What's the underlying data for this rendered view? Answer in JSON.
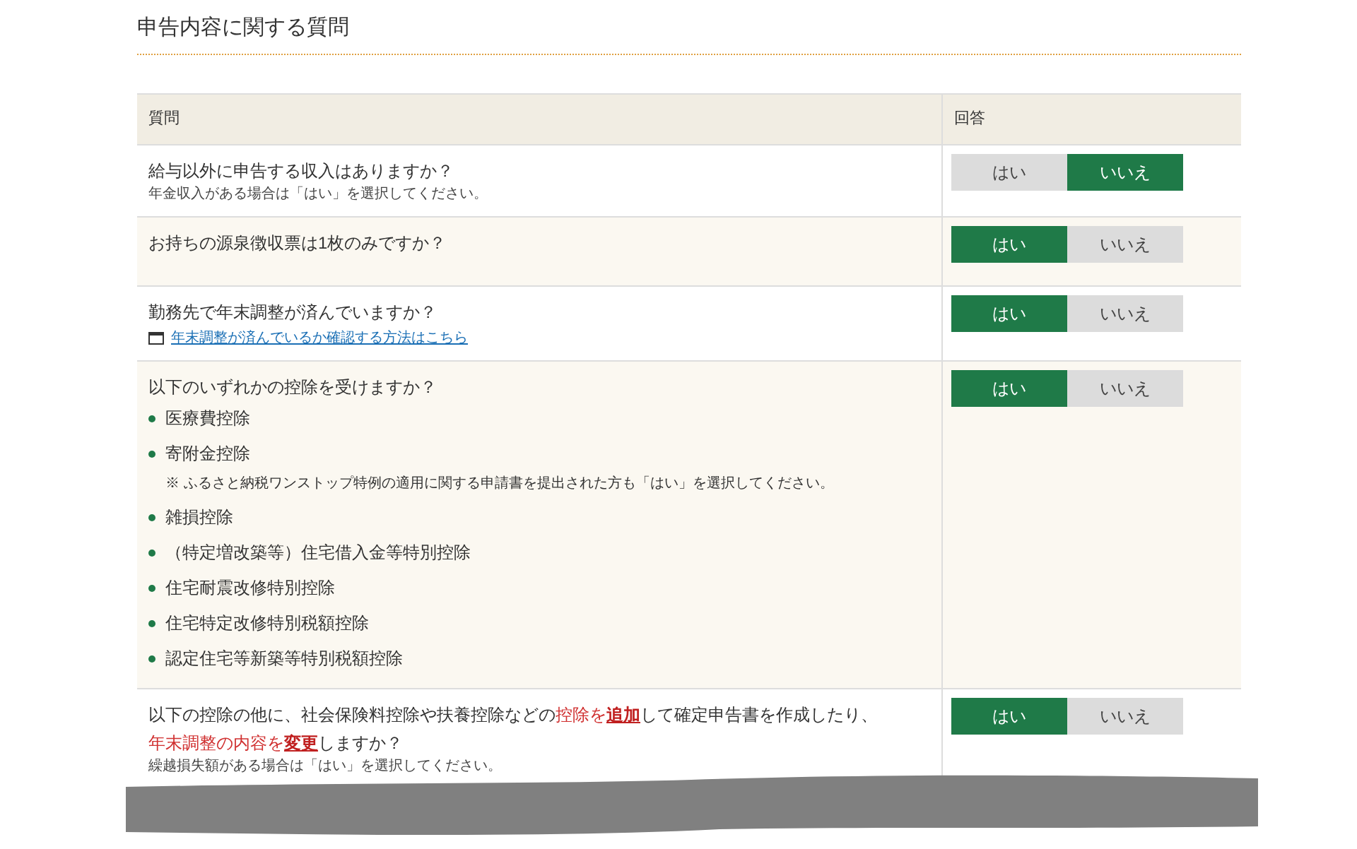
{
  "heading": "申告内容に関する質問",
  "table": {
    "columns": [
      "質問",
      "回答"
    ],
    "rows": [
      {
        "question": [
          [
            {
              "text": "給与以外に申告する収入はありますか？",
              "kind": "plain"
            }
          ]
        ],
        "note": "年金収入がある場合は「はい」を選択してください。",
        "options": [
          {
            "label": "はい",
            "selected": false
          },
          {
            "label": "いいえ",
            "selected": true
          }
        ]
      },
      {
        "question": [
          [
            {
              "text": "お持ちの源泉徴収票は1枚のみですか？",
              "kind": "plain"
            }
          ]
        ],
        "options": [
          {
            "label": "はい",
            "selected": true
          },
          {
            "label": "いいえ",
            "selected": false
          }
        ]
      },
      {
        "question": [
          [
            {
              "text": "勤務先で年末調整が済んでいますか？",
              "kind": "plain"
            }
          ]
        ],
        "link": "年末調整が済んでいるか確認する方法はこちら",
        "options": [
          {
            "label": "はい",
            "selected": true
          },
          {
            "label": "いいえ",
            "selected": false
          }
        ]
      },
      {
        "question": [
          [
            {
              "text": "以下のいずれかの控除を受けますか？",
              "kind": "plain"
            }
          ]
        ],
        "items": [
          {
            "text": "医療費控除"
          },
          {
            "text": "寄附金控除",
            "note": "※ ふるさと納税ワンストップ特例の適用に関する申請書を提出された方も「はい」を選択してください。"
          },
          {
            "text": "雑損控除"
          },
          {
            "text": "（特定増改築等）住宅借入金等特別控除"
          },
          {
            "text": "住宅耐震改修特別控除"
          },
          {
            "text": "住宅特定改修特別税額控除"
          },
          {
            "text": "認定住宅等新築等特別税額控除"
          }
        ],
        "options": [
          {
            "label": "はい",
            "selected": true
          },
          {
            "label": "いいえ",
            "selected": false
          }
        ]
      },
      {
        "question": [
          [
            {
              "text": "以下の控除の他に、社会保険料控除や扶養控除などの",
              "kind": "plain"
            },
            {
              "text": "控除を",
              "kind": "emphasis"
            },
            {
              "text": "追加",
              "kind": "strong"
            },
            {
              "text": "して確定申告書を作成したり、",
              "kind": "plain"
            }
          ],
          [
            {
              "text": "年末調整の内容を",
              "kind": "emphasis"
            },
            {
              "text": "変更",
              "kind": "strong"
            },
            {
              "text": "しますか？",
              "kind": "plain"
            }
          ]
        ],
        "note": "繰越損失額がある場合は「はい」を選択してください。",
        "options": [
          {
            "label": "はい",
            "selected": true
          },
          {
            "label": "いいえ",
            "selected": false
          }
        ]
      }
    ]
  }
}
